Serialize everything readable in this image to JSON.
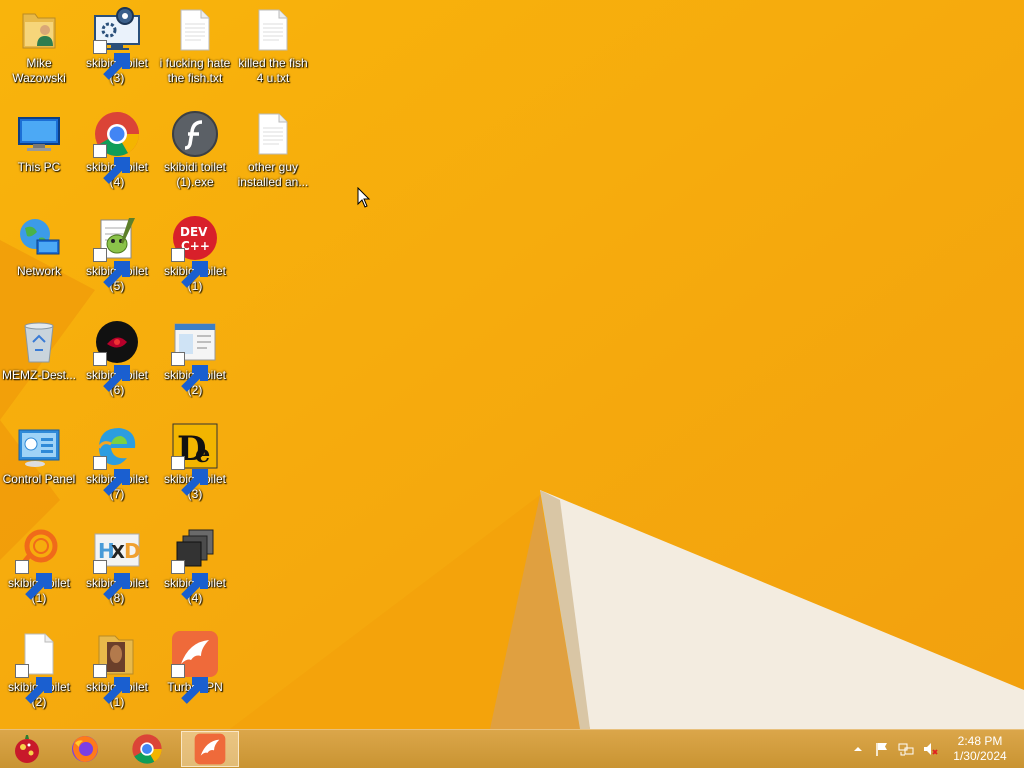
{
  "desktop": {
    "icons": [
      {
        "label": "Mike Wazowski"
      },
      {
        "label": "This PC"
      },
      {
        "label": "Network"
      },
      {
        "label": "MEMZ-Dest..."
      },
      {
        "label": "Control Panel"
      },
      {
        "label": "skibidi toilet (1)"
      },
      {
        "label": "skibidi toilet (2)"
      },
      {
        "label": "skibidi toilet (3)"
      },
      {
        "label": "skibidi toilet (4)"
      },
      {
        "label": "skibidi toilet (5)"
      },
      {
        "label": "skibidi toilet (6)"
      },
      {
        "label": "skibidi toilet (7)"
      },
      {
        "label": "skibidi toilet (8)"
      },
      {
        "label": "skibidi toilet (1)"
      },
      {
        "label": "i fucking hate the fish.txt"
      },
      {
        "label": "skibidi toilet (1).exe"
      },
      {
        "label": "skibidi toilet (1)"
      },
      {
        "label": "skibidi toilet (2)"
      },
      {
        "label": "skibidi toilet (3)"
      },
      {
        "label": "skibidi toilet (4)"
      },
      {
        "label": "TurboVPN"
      },
      {
        "label": "killed the fish 4 u.txt"
      },
      {
        "label": "other guy installed an..."
      }
    ]
  },
  "taskbar": {
    "apps": [
      "start-orb-icon",
      "firefox-icon",
      "chrome-icon",
      "turbovpn-icon"
    ],
    "clock": {
      "time": "2:48 PM",
      "date": "1/30/2024"
    }
  },
  "colors": {
    "wallpaper": "#f6ad0e",
    "taskbar": "#d19c3c"
  }
}
